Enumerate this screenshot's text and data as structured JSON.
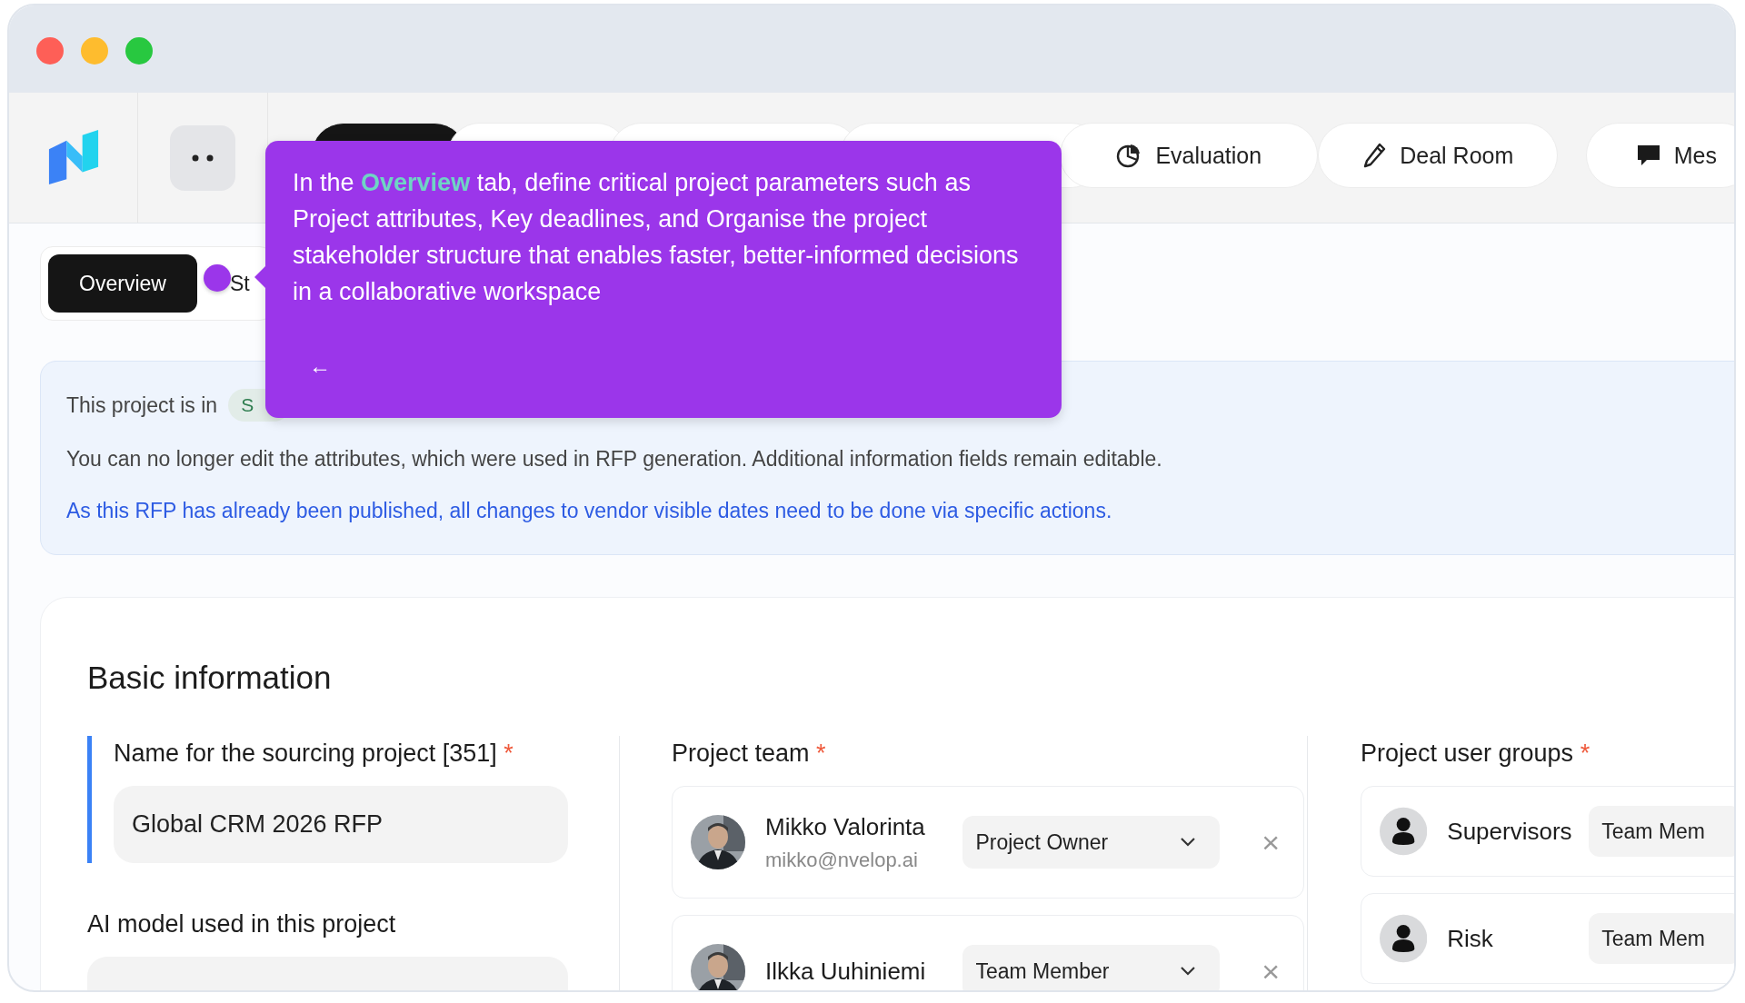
{
  "nav": {
    "tabs": [
      {
        "selected": true
      },
      {
        "selected": false
      },
      {
        "selected": false
      },
      {
        "selected": false
      },
      {
        "label": "Evaluation",
        "selected": false
      },
      {
        "label": "Deal Room",
        "selected": false
      },
      {
        "label": "Mes",
        "selected": false
      }
    ]
  },
  "sub_tabs": [
    {
      "label": "Overview",
      "selected": true
    },
    {
      "label": "St",
      "selected": false
    }
  ],
  "tooltip": {
    "text": "In the **Overview** tab, define critical project parameters such as Project attributes, Key deadlines, and Organise the project stakeholder structure that enables faster, better-informed decisions in a collaborative workspace",
    "back": "←"
  },
  "notice": {
    "status_prefix": "This project is in",
    "status_badge": "S",
    "message": "You can no longer edit the attributes, which were used in RFP generation. Additional information fields remain editable.",
    "link": "As this RFP has already been published, all changes to vendor visible dates need to be done via specific actions."
  },
  "basic_information": {
    "title": "Basic information",
    "name_field": {
      "label": "Name for the sourcing project [351]",
      "required_mark": "*",
      "value": "Global CRM 2026 RFP"
    },
    "ai_model_field": {
      "label": "AI model used in this project"
    },
    "project_team": {
      "label": "Project team",
      "required_mark": "*",
      "members": [
        {
          "name": "Mikko Valorinta",
          "email": "mikko@nvelop.ai",
          "role": "Project Owner",
          "remove": "×"
        },
        {
          "name": "Ilkka Uuhiniemi",
          "role": "Team Member",
          "remove": "×"
        }
      ]
    },
    "user_groups": {
      "label": "Project user groups",
      "required_mark": "*",
      "groups": [
        {
          "name": "Supervisors",
          "role": "Team Mem"
        },
        {
          "name": "Risk",
          "role": "Team Mem"
        }
      ]
    }
  }
}
